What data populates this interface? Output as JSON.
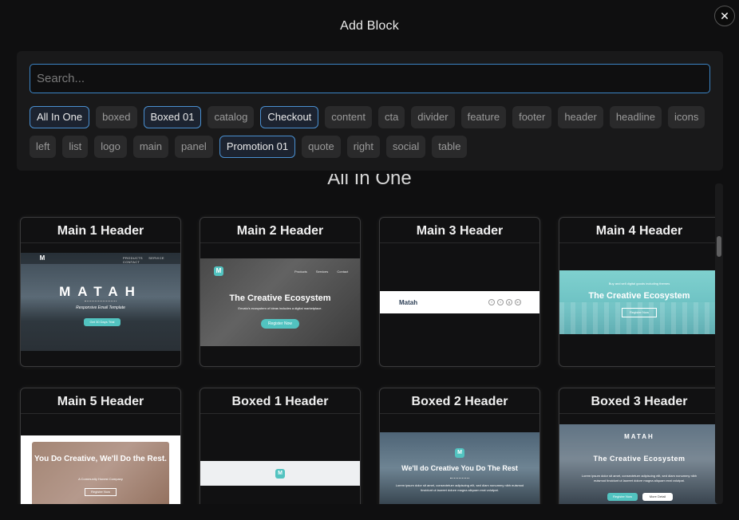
{
  "dialog": {
    "title": "Add Block",
    "close_label": "✕"
  },
  "search": {
    "placeholder": "Search..."
  },
  "tags": [
    {
      "label": "All In One",
      "active": true
    },
    {
      "label": "boxed",
      "active": false
    },
    {
      "label": "Boxed 01",
      "active": true
    },
    {
      "label": "catalog",
      "active": false
    },
    {
      "label": "Checkout",
      "active": true
    },
    {
      "label": "content",
      "active": false
    },
    {
      "label": "cta",
      "active": false
    },
    {
      "label": "divider",
      "active": false
    },
    {
      "label": "feature",
      "active": false
    },
    {
      "label": "footer",
      "active": false
    },
    {
      "label": "header",
      "active": false
    },
    {
      "label": "headline",
      "active": false
    },
    {
      "label": "icons",
      "active": false
    },
    {
      "label": "left",
      "active": false
    },
    {
      "label": "list",
      "active": false
    },
    {
      "label": "logo",
      "active": false
    },
    {
      "label": "main",
      "active": false
    },
    {
      "label": "panel",
      "active": false
    },
    {
      "label": "Promotion 01",
      "active": true
    },
    {
      "label": "quote",
      "active": false
    },
    {
      "label": "right",
      "active": false
    },
    {
      "label": "social",
      "active": false
    },
    {
      "label": "table",
      "active": false
    }
  ],
  "section": {
    "heading": "All In One"
  },
  "cards": [
    {
      "title": "Main 1 Header"
    },
    {
      "title": "Main 2 Header"
    },
    {
      "title": "Main 3 Header"
    },
    {
      "title": "Main 4 Header"
    },
    {
      "title": "Main 5 Header"
    },
    {
      "title": "Boxed 1 Header"
    },
    {
      "title": "Boxed 2 Header"
    },
    {
      "title": "Boxed 3 Header"
    }
  ],
  "previews": {
    "main1": {
      "logo": "M",
      "nav": [
        "PRODUCTS",
        "SERVICE",
        "CONTACT"
      ],
      "brand": "MATAH",
      "tagline": "Responsive Email Template",
      "button": "Get 30 Days Trial"
    },
    "main2": {
      "logo": "M",
      "nav": [
        "Products",
        "Services",
        "Contact"
      ],
      "heading": "The Creative Ecosystem",
      "sub": "Envato's ecosystem of ideas includes a digital marketplace.",
      "button": "Register Now"
    },
    "main3": {
      "brand": "Matah",
      "social": [
        "f",
        "t",
        "g",
        "in"
      ]
    },
    "main4": {
      "kicker": "Buy and sell digital goods including themes",
      "heading": "The Creative Ecosystem",
      "button": "Register Now"
    },
    "main5": {
      "heading": "You Do Creative, We'll Do the Rest.",
      "sub": "A Community Honest Company",
      "button": "Register Now"
    },
    "boxed1": {
      "logo": "M"
    },
    "boxed2": {
      "logo": "M",
      "heading": "We'll do Creative You Do The Rest",
      "body": "Lorem ipsum dolor sit amet, consectetuer adipiscing elit, sed diam nonummy nibh euismod tincidunt ut laoreet dolore magna aliquam erat volutpat."
    },
    "boxed3": {
      "brand": "MATAH",
      "heading": "The Creative Ecosystem",
      "body": "Lorem ipsum dolor sit amet, consectetuer adipiscing elit, sed diam nonummy nibh euismod tincidunt ut laoreet dolore magna aliquam erat volutpat.",
      "button_primary": "Register Now",
      "button_secondary": "More Detail"
    }
  },
  "colors": {
    "accent": "#4a8fd0",
    "teal": "#52c3c0",
    "background": "#0f0f10"
  }
}
